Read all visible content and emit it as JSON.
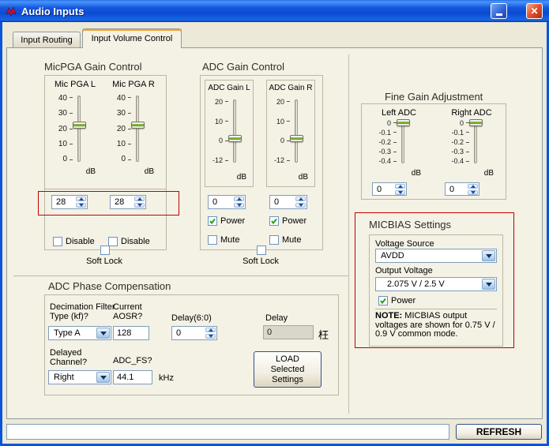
{
  "window": {
    "title": "Audio Inputs",
    "close_glyph": "✕"
  },
  "tabs": {
    "input_routing": "Input Routing",
    "input_volume": "Input Volume Control"
  },
  "micpga": {
    "heading": "MicPGA Gain Control",
    "left": {
      "label": "Mic PGA L",
      "value": "28"
    },
    "right": {
      "label": "Mic PGA R",
      "value": "28"
    },
    "ticks": [
      "40",
      "30",
      "20",
      "10",
      "0"
    ],
    "db": "dB",
    "disable_label": "Disable",
    "soft_lock_label": "Soft Lock"
  },
  "adc": {
    "heading": "ADC Gain Control",
    "left": {
      "label": "ADC Gain L",
      "value": "0"
    },
    "right": {
      "label": "ADC Gain R",
      "value": "0"
    },
    "ticks": [
      "20",
      "10",
      "0",
      "-12"
    ],
    "db": "dB",
    "power_label": "Power",
    "mute_label": "Mute",
    "soft_lock_label": "Soft Lock"
  },
  "fine_gain": {
    "heading": "Fine Gain Adjustment",
    "left": {
      "label": "Left ADC",
      "value": "0"
    },
    "right": {
      "label": "Right ADC",
      "value": "0"
    },
    "ticks": [
      "0",
      "-0.1",
      "-0.2",
      "-0.3",
      "-0.4"
    ],
    "db": "dB"
  },
  "micbias": {
    "heading": "MICBIAS Settings",
    "voltage_source_label": "Voltage Source",
    "voltage_source_value": "AVDD",
    "output_voltage_label": "Output Voltage",
    "output_voltage_value": "2.075 V / 2.5 V",
    "power_label": "Power",
    "note_bold": "NOTE:",
    "note_rest": " MICBIAS output voltages are shown for 0.75 V / 0.9 V common mode."
  },
  "phase": {
    "heading": "ADC Phase Compensation",
    "decimation_label": "Decimation Filter Type (kf)?",
    "decimation_value": "Type A",
    "aosr_label": "Current AOSR?",
    "aosr_value": "128",
    "delay_bits_label": "Delay(6:0)",
    "delay_bits_value": "0",
    "delay_label": "Delay",
    "delay_value": "0",
    "delay_unit": "枉",
    "delayed_channel_label": "Delayed Channel?",
    "delayed_channel_value": "Right",
    "adc_fs_label": "ADC_FS?",
    "adc_fs_value": "44.1",
    "adc_fs_unit": "kHz",
    "load_button": "LOAD Selected Settings"
  },
  "footer": {
    "status_value": "",
    "refresh_button": "REFRESH"
  }
}
